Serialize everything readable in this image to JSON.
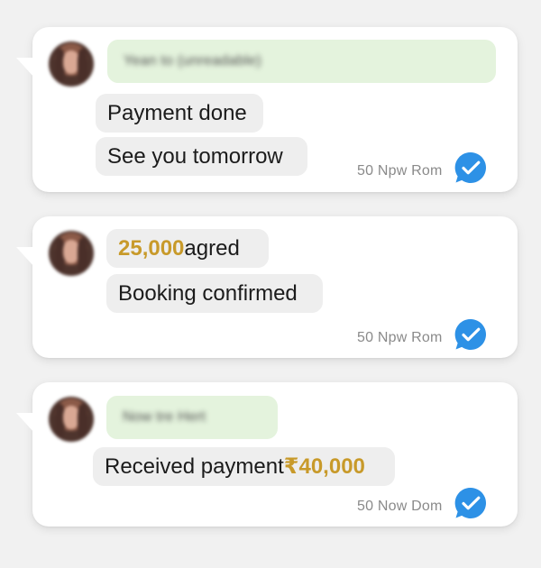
{
  "messages": [
    {
      "blur_text": "Yean to (unreadable)",
      "lines": [
        {
          "text": "Payment done"
        },
        {
          "text": "See you tomorrow"
        }
      ],
      "time": "50 Npw Rom",
      "status_icon": "double-check-badge-icon"
    },
    {
      "lines": [
        {
          "amount": "25,000",
          "text": " agred"
        },
        {
          "text": "Booking confirmed"
        }
      ],
      "time": "50 Npw Rom",
      "status_icon": "double-check-badge-icon"
    },
    {
      "blur_text": "Now tre Hert",
      "lines": [
        {
          "text": "Received payment ",
          "amount": "₹40,000"
        }
      ],
      "time": "50 Now Dom",
      "status_icon": "double-check-badge-icon"
    }
  ],
  "colors": {
    "background": "#f1f1f1",
    "card": "#ffffff",
    "blurred_bubble": "#e4f3dd",
    "text_bubble": "#eeeeee",
    "amount": "#c89a2a",
    "status_badge": "#2d91e6"
  }
}
